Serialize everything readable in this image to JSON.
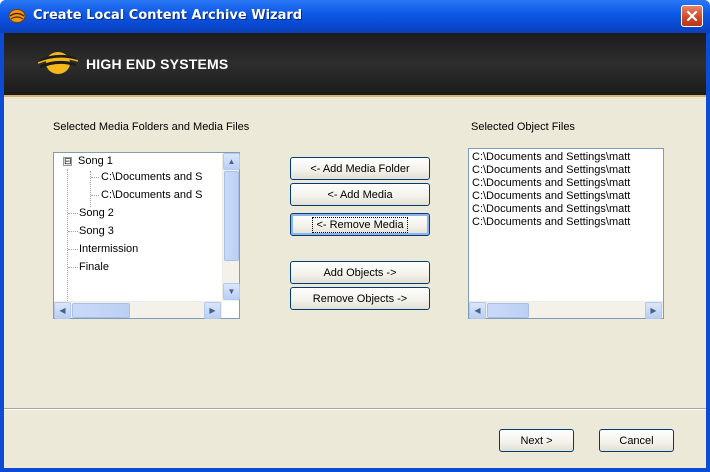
{
  "window": {
    "title": "Create Local Content Archive Wizard",
    "colors": {
      "titlebar": "#0e5ae8",
      "header": "#1c1c1c",
      "accent": "#d6b46a"
    }
  },
  "header": {
    "brand": "HIGH END SYSTEMS",
    "logo_icon": "high-end-systems-logo"
  },
  "media_panel": {
    "label": "Selected Media Folders and Media Files",
    "tree": [
      {
        "label": "Song 1",
        "expanded": true,
        "expander": "⊟"
      },
      {
        "label": "C:\\Documents and S",
        "child": true
      },
      {
        "label": "C:\\Documents and S",
        "child": true
      },
      {
        "label": "Song 2"
      },
      {
        "label": "Song 3"
      },
      {
        "label": "Intermission"
      },
      {
        "label": "Finale"
      }
    ]
  },
  "buttons": {
    "add_media_folder": "<- Add Media Folder",
    "add_media": "<- Add Media",
    "remove_media": "<- Remove Media",
    "add_objects": "Add Objects ->",
    "remove_objects": "Remove Objects ->"
  },
  "objects_panel": {
    "label": "Selected Object Files",
    "files": [
      "C:\\Documents and Settings\\matt",
      "C:\\Documents and Settings\\matt",
      "C:\\Documents and Settings\\matt",
      "C:\\Documents and Settings\\matt",
      "C:\\Documents and Settings\\matt",
      "C:\\Documents and Settings\\matt"
    ]
  },
  "footer": {
    "next": "Next >",
    "cancel": "Cancel"
  }
}
